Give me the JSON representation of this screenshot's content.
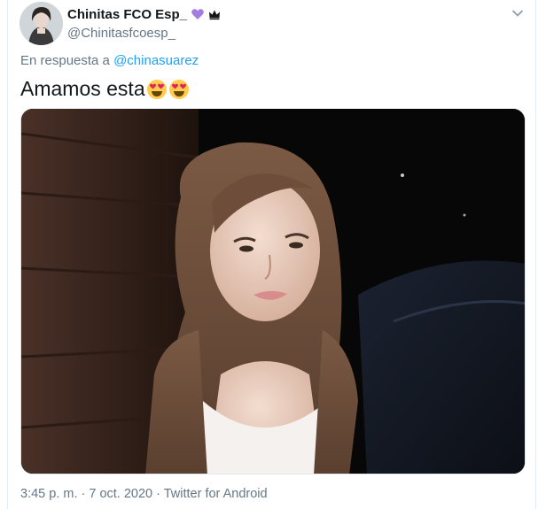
{
  "user": {
    "display_name": "Chinitas FCO Esp_",
    "handle": "@Chinitasfcoesp_",
    "name_icons": [
      "purple-heart-icon",
      "crown-icon"
    ]
  },
  "reply": {
    "prefix": "En respuesta a",
    "mention": "@chinasuarez"
  },
  "tweet": {
    "text": "Amamos esta",
    "emojis": [
      "heart-eyes-emoji",
      "heart-eyes-emoji"
    ]
  },
  "meta": {
    "line": "3:45 p. m. · 7 oct. 2020 · Twitter for Android"
  },
  "colors": {
    "link": "#1da1f2",
    "secondary_text": "#657786",
    "heart": "#a57de0"
  }
}
